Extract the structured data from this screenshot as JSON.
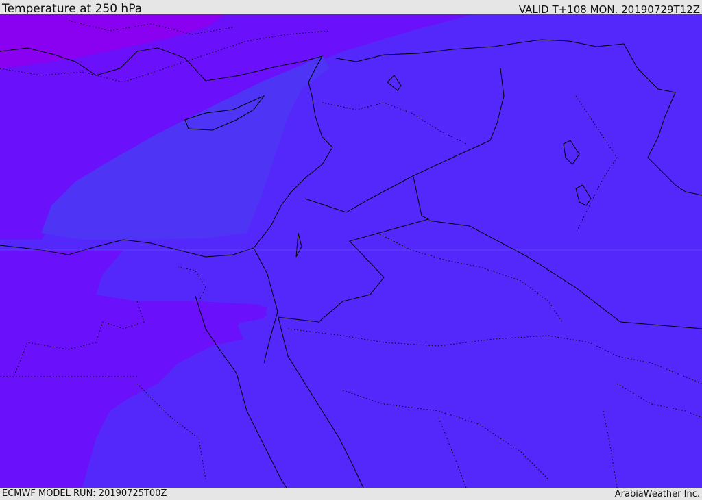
{
  "header": {
    "title": "Temperature at 250 hPa",
    "valid": "VALID T+108 MON. 20190729T12Z"
  },
  "footer": {
    "model_run": "ECMWF MODEL RUN: 20190725T00Z",
    "credit": "ArabiaWeather Inc."
  },
  "colors": {
    "band_coldest": "#8a00f0",
    "band_cold": "#6a10fa",
    "band_main": "#5428fb",
    "band_mid": "#4e34f4",
    "boundary_line": "#000000"
  }
}
